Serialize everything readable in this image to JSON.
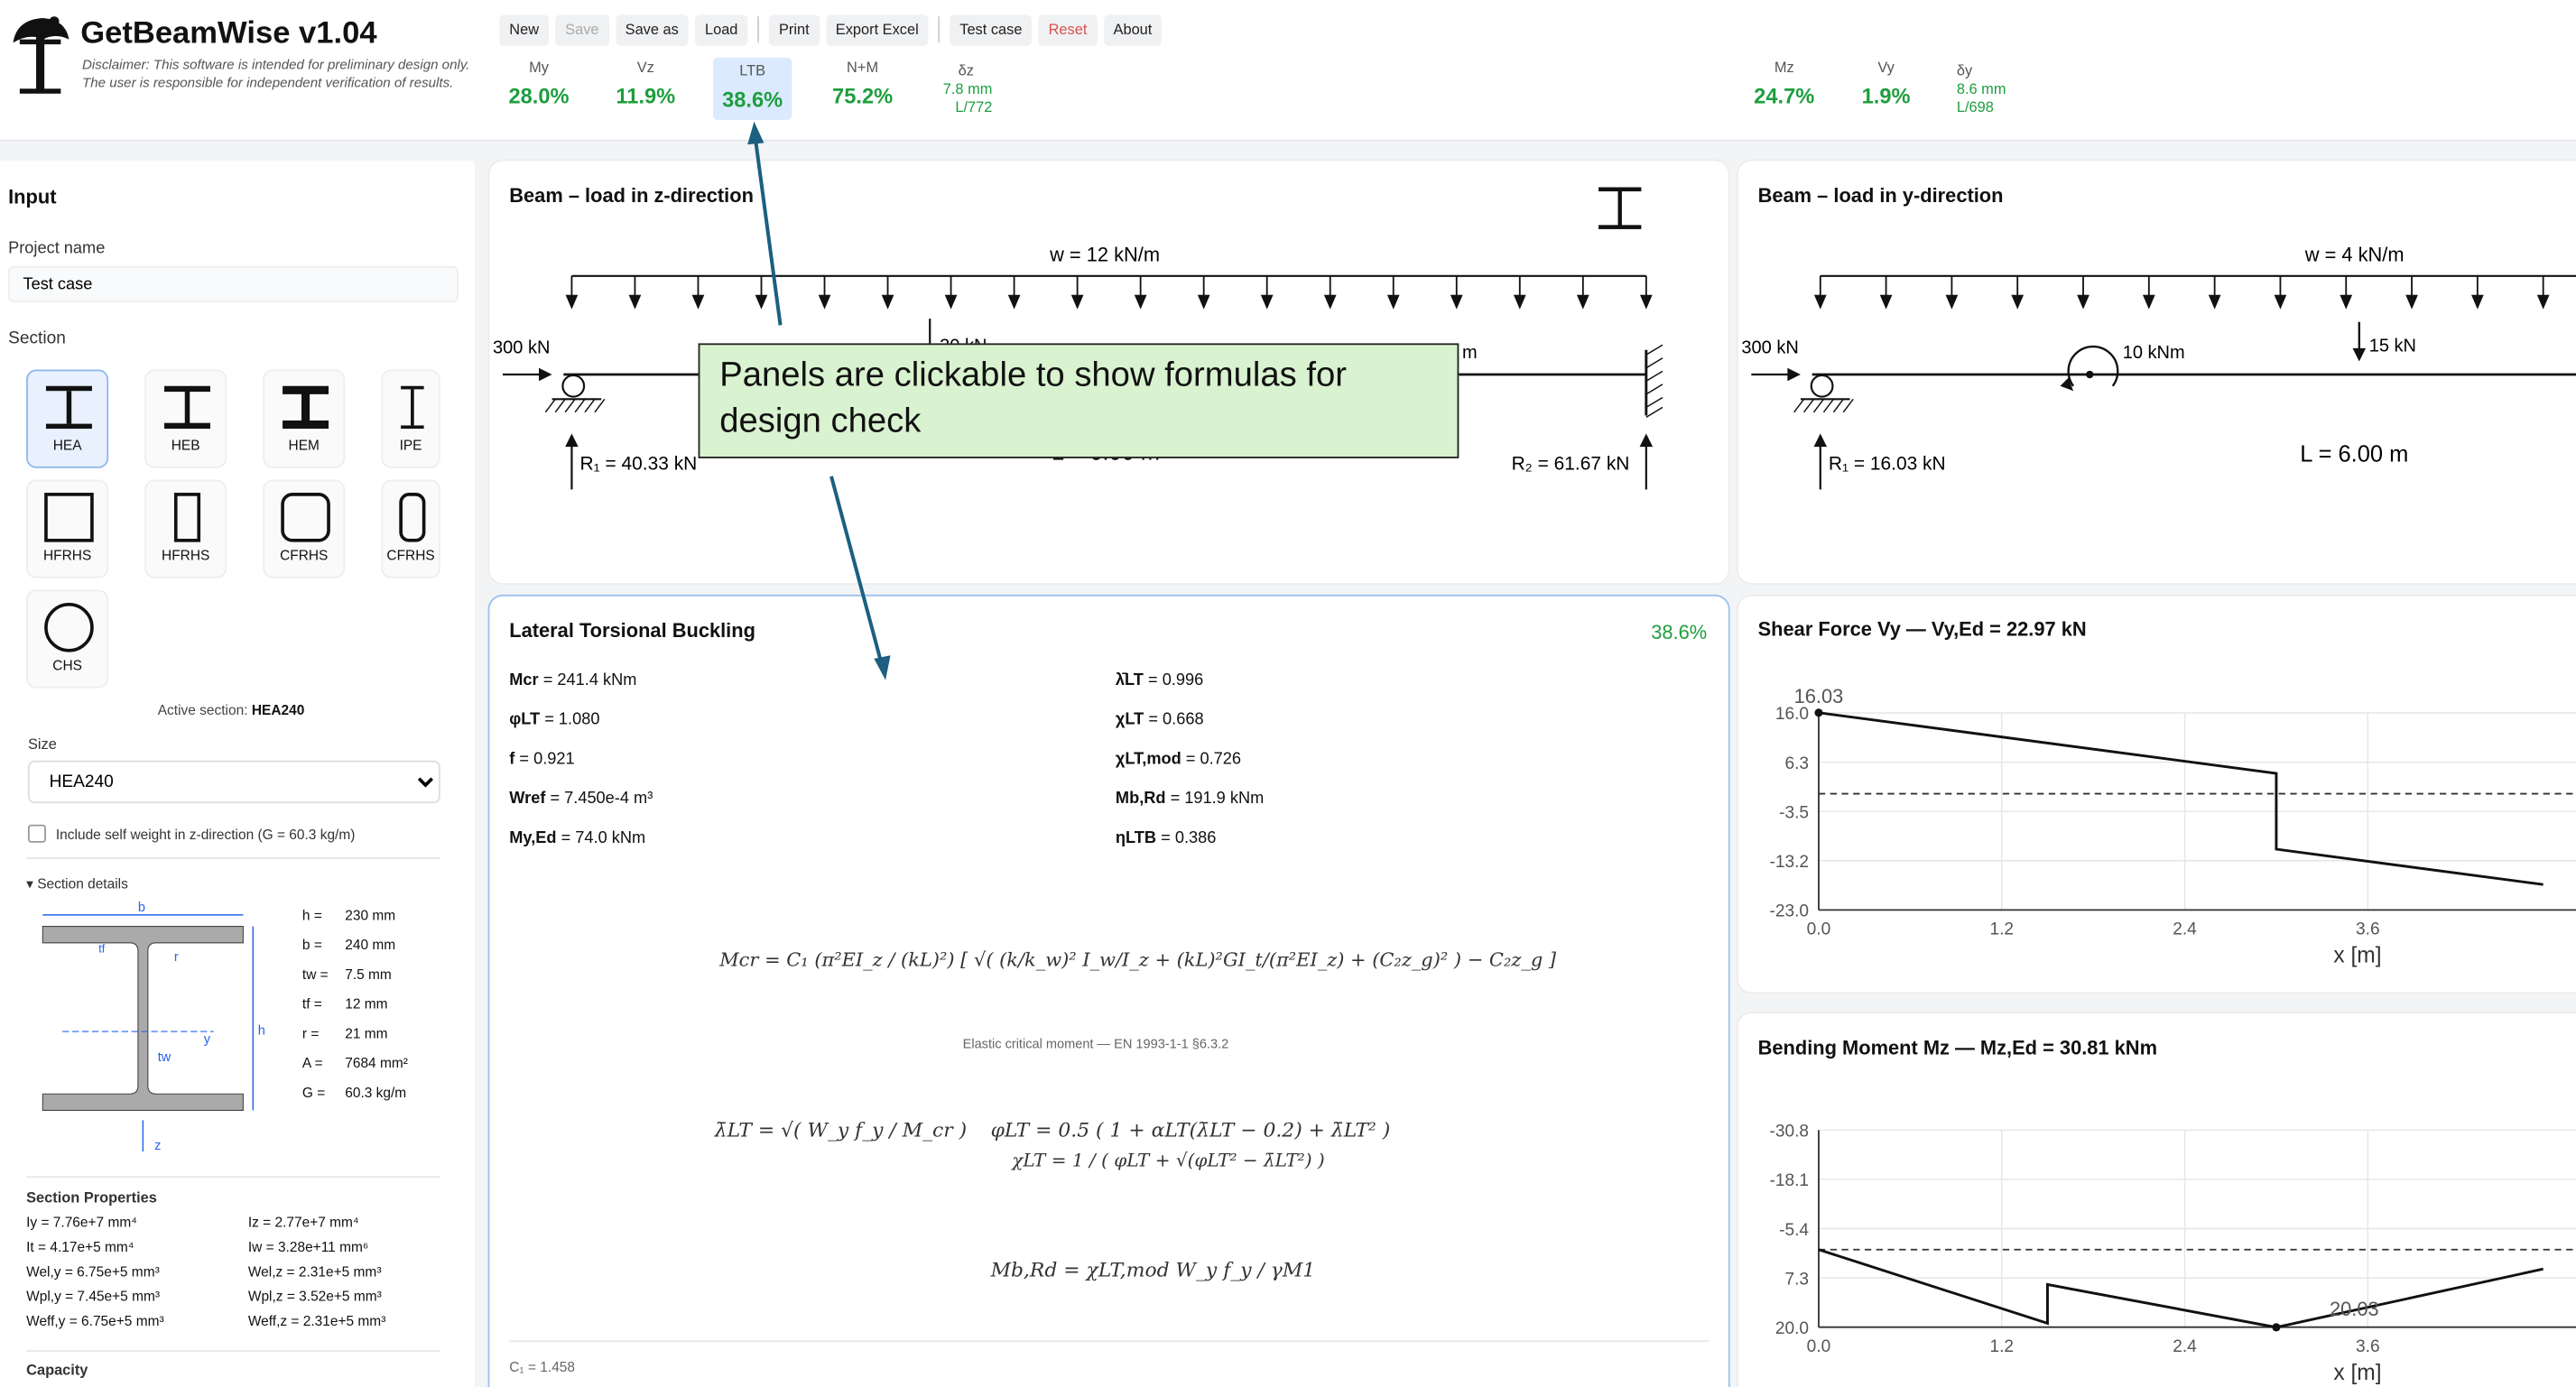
{
  "header": {
    "title": "GetBeamWise v1.04",
    "disclaimer_1": "Disclaimer: This software is intended for preliminary design only.",
    "disclaimer_2": "The user is responsible for independent verification of results."
  },
  "toolbar": {
    "new": "New",
    "save": "Save",
    "save_as": "Save as",
    "load": "Load",
    "print": "Print",
    "export_excel": "Export Excel",
    "test_case": "Test case",
    "reset": "Reset",
    "about": "About"
  },
  "utilization_z": [
    {
      "label": "My",
      "value": "28.0%"
    },
    {
      "label": "Vz",
      "value": "11.9%"
    },
    {
      "label": "LTB",
      "value": "38.6%"
    },
    {
      "label": "N+M",
      "value": "75.2%"
    }
  ],
  "deflection_z": {
    "label": "δz",
    "mm": "7.8 mm",
    "ratio": "L/772"
  },
  "utilization_y": [
    {
      "label": "Mz",
      "value": "24.7%"
    },
    {
      "label": "Vy",
      "value": "1.9%"
    }
  ],
  "deflection_y": {
    "label": "δy",
    "mm": "8.6 mm",
    "ratio": "L/698"
  },
  "input": {
    "heading": "Input",
    "project_label": "Project name",
    "project_value": "Test case",
    "section_label": "Section",
    "sections": [
      "HEA",
      "HEB",
      "HEM",
      "IPE",
      "HFRHS",
      "HFRHS",
      "CFRHS",
      "CFRHS",
      "CHS"
    ],
    "active_section_label": "Active section:",
    "active_section": "HEA240",
    "size_label": "Size",
    "size_value": "HEA240",
    "self_weight_label": "Include self weight in z-direction (G = 60.3 kg/m)",
    "section_details_label": "▾ Section details",
    "details": [
      {
        "k": "h =",
        "v": "230 mm"
      },
      {
        "k": "b =",
        "v": "240 mm"
      },
      {
        "k": "tw =",
        "v": "7.5 mm"
      },
      {
        "k": "tf =",
        "v": "12 mm"
      },
      {
        "k": "r =",
        "v": "21 mm"
      },
      {
        "k": "A =",
        "v": "7684 mm²"
      },
      {
        "k": "G =",
        "v": "60.3 kg/m"
      }
    ],
    "section_properties_label": "Section Properties",
    "properties": [
      [
        "Iy = 7.76e+7 mm⁴",
        "Iz = 2.77e+7 mm⁴"
      ],
      [
        "It = 4.17e+5 mm⁴",
        "Iw = 3.28e+11 mm⁶"
      ],
      [
        "Wel,y = 6.75e+5 mm³",
        "Wel,z = 2.31e+5 mm³"
      ],
      [
        "Wpl,y = 7.45e+5 mm³",
        "Wpl,z = 3.52e+5 mm³"
      ],
      [
        "Weff,y = 6.75e+5 mm³",
        "Weff,z = 2.31e+5 mm³"
      ]
    ],
    "capacity_label": "Capacity",
    "diagram_labels": {
      "b": "b",
      "y": "y",
      "z": "z",
      "h": "h",
      "r": "r",
      "tw": "tw",
      "tf": "tf"
    }
  },
  "beam_z": {
    "title": "Beam – load in z-direction",
    "load": "w = 12 kN/m",
    "axial": "300 kN",
    "point": "30 kN",
    "moment": "m",
    "span": "L = 6.00 m",
    "r1": "R₁ = 40.33 kN",
    "r2": "R₂ = 61.67 kN"
  },
  "beam_y": {
    "title": "Beam – load in y-direction",
    "load": "w = 4 kN/m",
    "axial": "300 kN",
    "moment": "10 kNm",
    "point": "15 kN",
    "span": "L = 6.00 m",
    "r1": "R₁ = 16.03 kN"
  },
  "callout": {
    "text": "Panels are clickable to show formulas for design check"
  },
  "ltb": {
    "title": "Lateral Torsional Buckling",
    "util": "38.6%",
    "left": [
      {
        "sym": "Mcr",
        "val": " = 241.4 kNm"
      },
      {
        "sym": "φLT",
        "val": " = 1.080"
      },
      {
        "sym": "f",
        "val": " = 0.921"
      },
      {
        "sym": "Wref",
        "val": " = 7.450e-4 m³"
      },
      {
        "sym": "My,Ed",
        "val": " = 74.0 kNm"
      }
    ],
    "right": [
      {
        "sym": "λ̄LT",
        "val": " = 0.996"
      },
      {
        "sym": "χLT",
        "val": " = 0.668"
      },
      {
        "sym": "χLT,mod",
        "val": " = 0.726"
      },
      {
        "sym": "Mb,Rd",
        "val": " = 191.9 kNm"
      },
      {
        "sym": "ηLTB",
        "val": " = 0.386"
      }
    ],
    "formula_mcr": "Mcr = C₁ (π²EI_z / (kL)²) [ √( (k/k_w)² I_w/I_z + (kL)²GI_t/(π²EI_z) + (C₂z_g)² ) − C₂z_g ]",
    "mcr_note": "Elastic critical moment — EN 1993-1-1 §6.3.2",
    "formula_lambda": "λ̄LT = √( W_y f_y / M_cr )",
    "formula_phi": "φLT = 0.5 ( 1 + αLT(λ̄LT − 0.2) + λ̄LT² )",
    "formula_chi": "χLT = 1 / ( φLT + √(φLT² − λ̄LT²) )",
    "formula_mbrd": "Mb,Rd = χLT,mod W_y f_y / γM1",
    "c1": "C₁ = 1.458"
  },
  "shear_chart": {
    "title": "Shear Force Vy — Vy,Ed = 22.97 kN",
    "max_label": "16.03",
    "yticks": [
      "16.0",
      "6.3",
      "-3.5",
      "-13.2",
      "-23.0"
    ],
    "xticks": [
      "0.0",
      "1.2",
      "2.4",
      "3.6"
    ],
    "xlabel": "x [m]"
  },
  "moment_chart": {
    "title": "Bending Moment Mz — Mz,Ed = 30.81 kNm",
    "max_label": "20.03",
    "yticks": [
      "-30.8",
      "-18.1",
      "-5.4",
      "7.3",
      "20.0"
    ],
    "xticks": [
      "0.0",
      "1.2",
      "2.4",
      "3.6"
    ],
    "xlabel": "x [m]"
  },
  "chart_data": [
    {
      "type": "line",
      "title": "Shear Force Vy — Vy,Ed = 22.97 kN",
      "xlabel": "x [m]",
      "ylabel": "",
      "x": [
        0,
        3.0,
        3.0,
        4.75
      ],
      "y": [
        16.03,
        4.03,
        -10.97,
        -17.97
      ],
      "ylim": [
        -23.0,
        16.0
      ],
      "xlim": [
        0,
        4.75
      ],
      "annotations": [
        "16.03"
      ]
    },
    {
      "type": "line",
      "title": "Bending Moment Mz — Mz,Ed = 30.81 kNm",
      "xlabel": "x [m]",
      "ylabel": "",
      "x": [
        0,
        1.5,
        1.5,
        3.0,
        4.75
      ],
      "y": [
        0,
        19.0,
        9.0,
        20.03,
        5.0
      ],
      "ylim": [
        -30.8,
        20.0
      ],
      "xlim": [
        0,
        4.75
      ],
      "annotations": [
        "20.03"
      ]
    }
  ]
}
